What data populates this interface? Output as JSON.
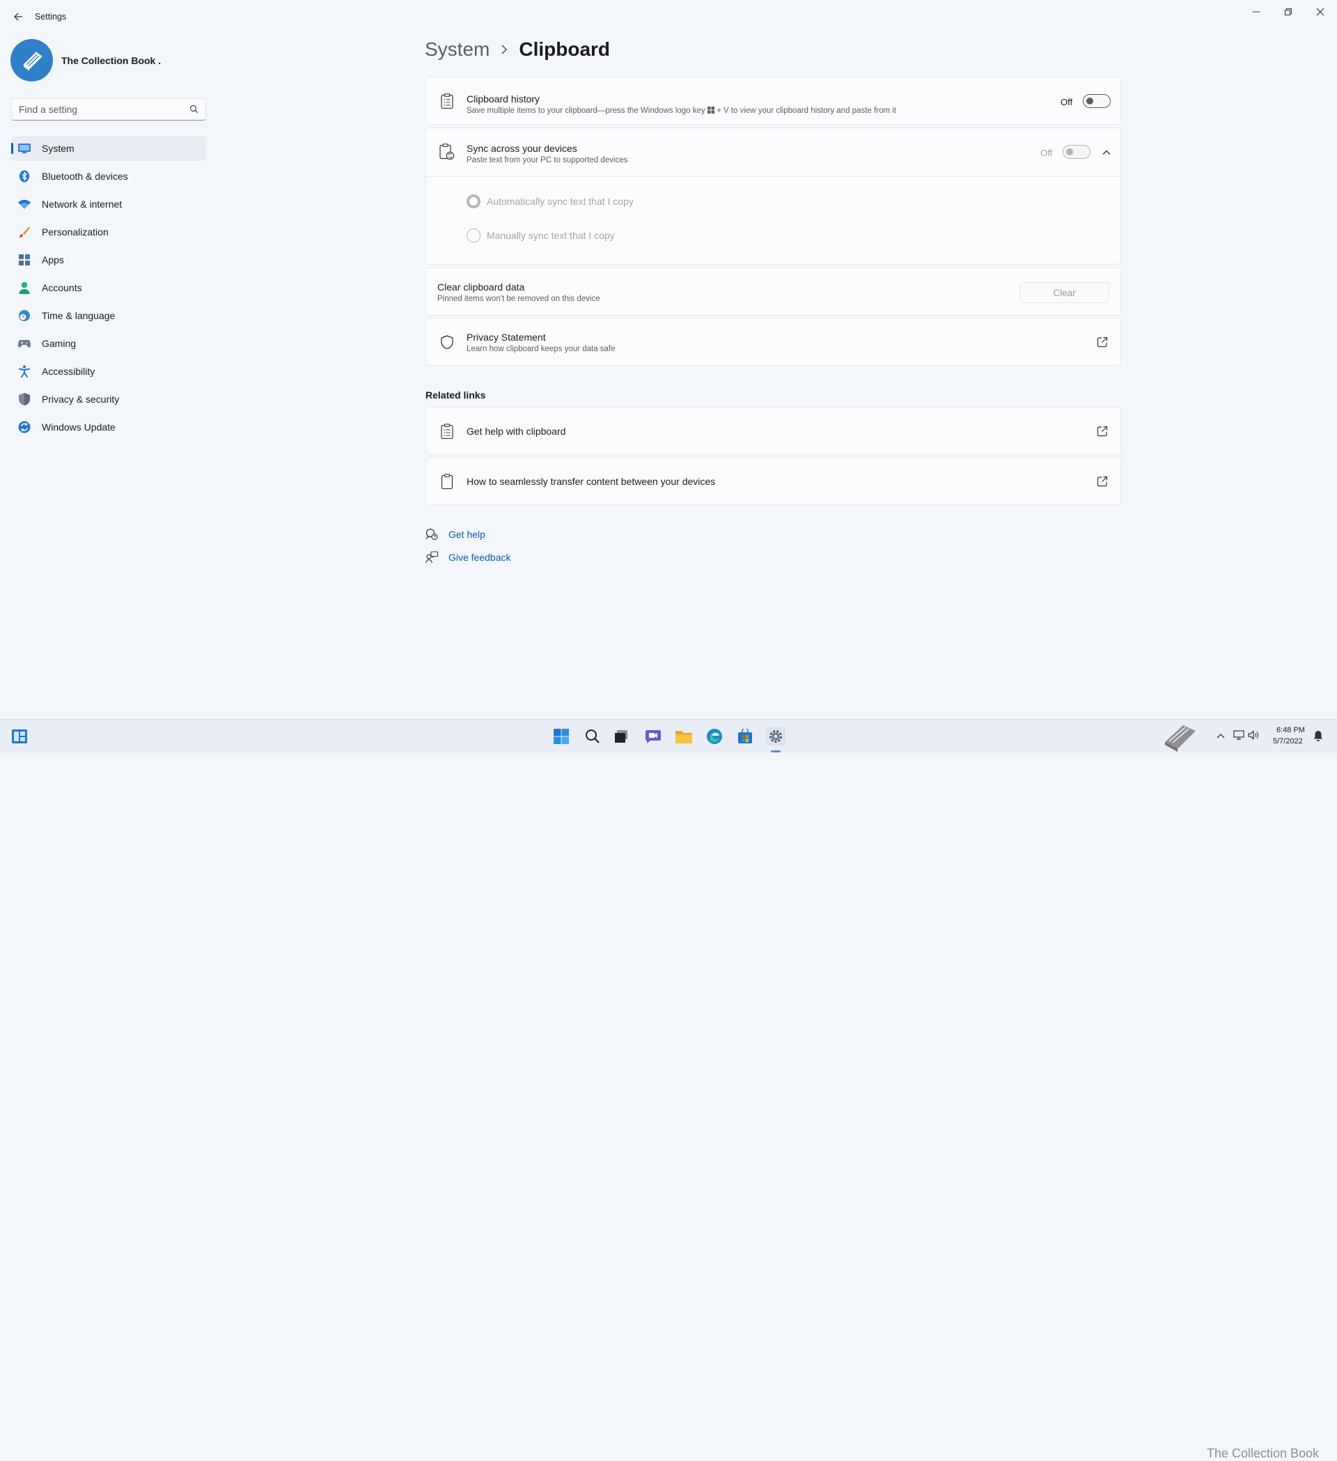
{
  "window": {
    "title": "Settings"
  },
  "profile": {
    "name": "The Collection Book ."
  },
  "search": {
    "placeholder": "Find a setting"
  },
  "sidebar": {
    "items": [
      {
        "label": "System",
        "icon": "system-icon"
      },
      {
        "label": "Bluetooth & devices",
        "icon": "bluetooth-icon"
      },
      {
        "label": "Network & internet",
        "icon": "wifi-icon"
      },
      {
        "label": "Personalization",
        "icon": "brush-icon"
      },
      {
        "label": "Apps",
        "icon": "apps-icon"
      },
      {
        "label": "Accounts",
        "icon": "person-icon"
      },
      {
        "label": "Time & language",
        "icon": "globe-clock-icon"
      },
      {
        "label": "Gaming",
        "icon": "gamepad-icon"
      },
      {
        "label": "Accessibility",
        "icon": "accessibility-icon"
      },
      {
        "label": "Privacy & security",
        "icon": "shield-icon"
      },
      {
        "label": "Windows Update",
        "icon": "update-icon"
      }
    ],
    "active": "System"
  },
  "breadcrumb": {
    "parent": "System",
    "current": "Clipboard"
  },
  "settings": {
    "history": {
      "title": "Clipboard history",
      "description": "Save multiple items to your clipboard—press the Windows logo key",
      "description_tail": "+ V to view your clipboard history and paste from it",
      "state": "Off"
    },
    "sync": {
      "title": "Sync across your devices",
      "description": "Paste text from your PC to supported devices",
      "state": "Off",
      "options": [
        {
          "label": "Automatically sync text that I copy",
          "selected": true
        },
        {
          "label": "Manually sync text that I copy",
          "selected": false
        }
      ]
    },
    "clear": {
      "title": "Clear clipboard data",
      "description": "Pinned items won't be removed on this device",
      "button": "Clear"
    },
    "privacy": {
      "title": "Privacy Statement",
      "description": "Learn how clipboard keeps your data safe"
    }
  },
  "related": {
    "title": "Related links",
    "links": [
      {
        "label": "Get help with clipboard"
      },
      {
        "label": "How to seamlessly transfer content between your devices"
      }
    ]
  },
  "help": {
    "get_help": "Get help",
    "feedback": "Give feedback"
  },
  "taskbar": {
    "icons": [
      "start-icon",
      "search-icon",
      "task-view-icon",
      "chat-icon",
      "file-explorer-icon",
      "edge-icon",
      "store-icon",
      "settings-icon"
    ],
    "time": "6:48 PM",
    "date": "5/7/2022",
    "watermark": "The Collection Book"
  },
  "colors": {
    "accent": "#005fb8",
    "link": "#0f5aa6",
    "background": "#f3f6fb"
  }
}
